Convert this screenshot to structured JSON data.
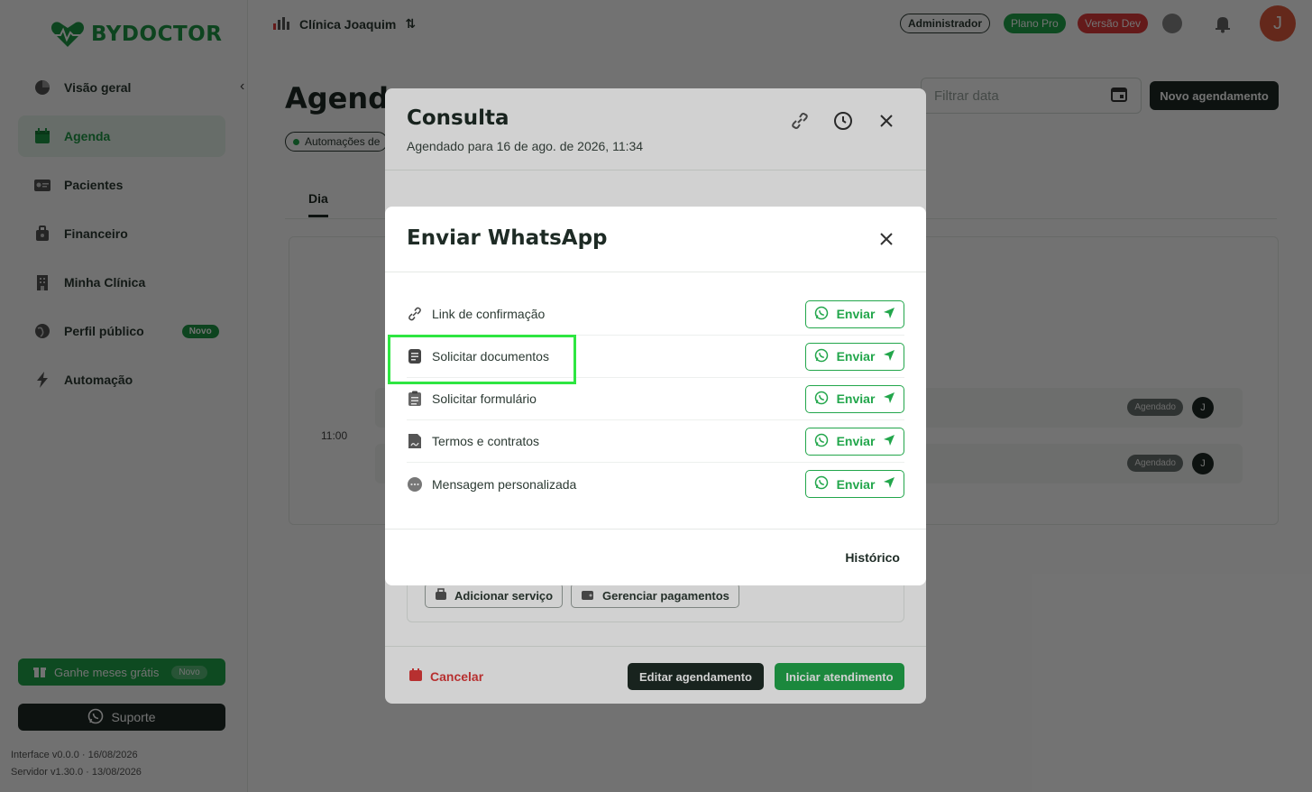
{
  "brand": {
    "name": "BYDOCTOR",
    "color": "#1f9a45"
  },
  "sidebar": {
    "items": [
      {
        "label": "Visão geral",
        "icon": "pie-chart-icon"
      },
      {
        "label": "Agenda",
        "icon": "calendar-icon",
        "active": true
      },
      {
        "label": "Pacientes",
        "icon": "id-card-icon"
      },
      {
        "label": "Financeiro",
        "icon": "wallet-icon"
      },
      {
        "label": "Minha Clínica",
        "icon": "building-icon"
      },
      {
        "label": "Perfil público",
        "icon": "globe-icon",
        "badge": "Novo"
      },
      {
        "label": "Automação",
        "icon": "bolt-icon"
      }
    ],
    "promo": {
      "label": "Ganhe meses grátis",
      "badge": "Novo"
    },
    "support": "Suporte",
    "version_interface": "Interface v0.0.0 · 16/08/2026",
    "version_server": "Servidor v1.30.0 · 13/08/2026"
  },
  "topbar": {
    "clinic": "Clínica Joaquim",
    "role": "Administrador",
    "plan": "Plano Pro",
    "env": "Versão Dev",
    "avatar_initial": "J"
  },
  "main": {
    "title": "Agenda",
    "automation_chip": "Automações de",
    "filter_placeholder": "Filtrar data",
    "new_appointment": "Novo agendamento",
    "tab_day": "Dia",
    "time_label": "11:00",
    "appointments": [
      {
        "status": "Agendado",
        "avatar": "J"
      },
      {
        "status": "Agendado",
        "avatar": "J"
      }
    ]
  },
  "consulta": {
    "title": "Consulta",
    "subtitle": "Agendado para 16 de ago. de 2026, 11:34",
    "add_service": "Adicionar serviço",
    "manage_payments": "Gerenciar pagamentos",
    "cancel": "Cancelar",
    "edit": "Editar agendamento",
    "start": "Iniciar atendimento"
  },
  "whatsapp_modal": {
    "title": "Enviar WhatsApp",
    "send_label": "Enviar",
    "rows": [
      {
        "label": "Link de confirmação",
        "icon": "link-icon"
      },
      {
        "label": "Solicitar documentos",
        "icon": "document-icon"
      },
      {
        "label": "Solicitar formulário",
        "icon": "clipboard-icon"
      },
      {
        "label": "Termos e contratos",
        "icon": "contract-icon"
      },
      {
        "label": "Mensagem personalizada",
        "icon": "chat-bubble-icon"
      }
    ],
    "history": "Histórico"
  },
  "colors": {
    "accent_green": "#22a64b",
    "danger_red": "#e03b3b",
    "dark": "#1e2b25",
    "highlight": "#2ee641"
  }
}
